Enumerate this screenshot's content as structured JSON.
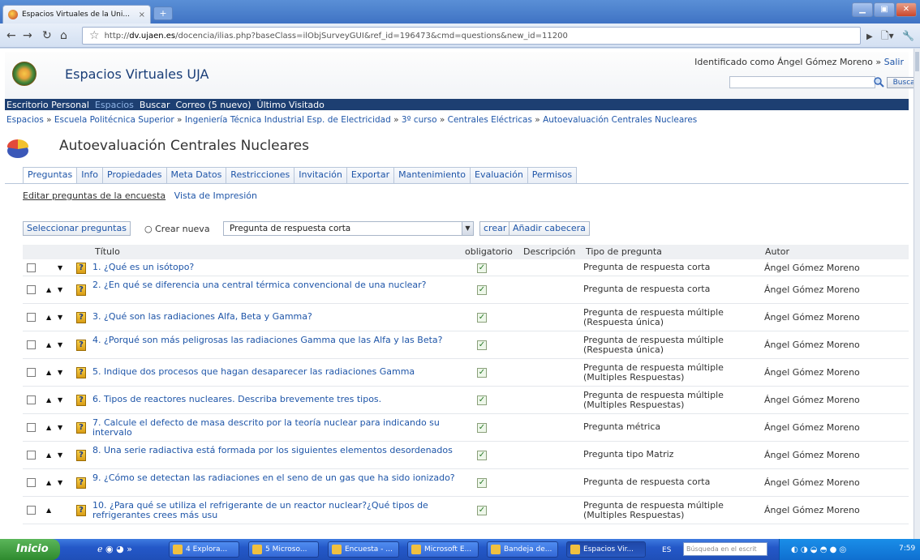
{
  "browser": {
    "tab_title": "Espacios Virtuales de la Uni...",
    "tab_close": "×",
    "new_tab": "+",
    "url_prefix": "http://",
    "url_host": "dv.ujaen.es",
    "url_rest": "/docencia/ilias.php?baseClass=ilObjSurveyGUI&ref_id=196473&cmd=questions&new_id=11200"
  },
  "header": {
    "site_title": "Espacios Virtuales UJA",
    "ident_text": "Identificado como Ángel Gómez Moreno » ",
    "logout": "Salir",
    "search_button": "Buscar"
  },
  "mainnav": [
    "Escritorio Personal",
    "Espacios",
    "Buscar",
    "Correo (5 nuevo)",
    "Último Visitado"
  ],
  "breadcrumbs": [
    "Espacios",
    "Escuela Politécnica Superior",
    "Ingeniería Técnica Industrial Esp. de Electricidad",
    "3º curso",
    "Centrales Eléctricas",
    "Autoevaluación Centrales Nucleares"
  ],
  "page_title": "Autoevaluación Centrales Nucleares",
  "tabs": [
    "Preguntas",
    "Info",
    "Propiedades",
    "Meta Datos",
    "Restricciones",
    "Invitación",
    "Exportar",
    "Mantenimiento",
    "Evaluación",
    "Permisos"
  ],
  "subtabs": [
    "Editar preguntas de la encuesta",
    "Vista de Impresión"
  ],
  "controls": {
    "select_questions": "Seleccionar preguntas",
    "create_new": "Crear nueva",
    "question_type": "Pregunta de respuesta corta",
    "create": "crear",
    "add_header": "Añadir cabecera"
  },
  "table": {
    "headers": [
      "Título",
      "obligatorio",
      "Descripción",
      "Tipo de pregunta",
      "Autor"
    ],
    "rows": [
      {
        "title": "1. ¿Qué es un isótopo?",
        "type": "Pregunta de respuesta corta",
        "author": "Ángel Gómez Moreno"
      },
      {
        "title": "2. ¿En qué se diferencia una central térmica convencional de una nuclear?",
        "type": "Pregunta de respuesta corta",
        "author": "Ángel Gómez Moreno"
      },
      {
        "title": "3. ¿Qué son las radiaciones Alfa, Beta y Gamma?",
        "type": "Pregunta de respuesta múltiple (Respuesta única)",
        "author": "Ángel Gómez Moreno"
      },
      {
        "title": "4. ¿Porqué son más peligrosas las radiaciones Gamma que las Alfa y las Beta?",
        "type": "Pregunta de respuesta múltiple (Respuesta única)",
        "author": "Ángel Gómez Moreno"
      },
      {
        "title": "5. Indique dos procesos que hagan desaparecer las radiaciones Gamma",
        "type": "Pregunta de respuesta múltiple (Multiples Respuestas)",
        "author": "Ángel Gómez Moreno"
      },
      {
        "title": "6. Tipos de reactores nucleares. Describa brevemente tres tipos.",
        "type": "Pregunta de respuesta múltiple (Multiples Respuestas)",
        "author": "Ángel Gómez Moreno"
      },
      {
        "title": "7. Calcule el defecto de masa descrito por la teoría nuclear para indicando su intervalo",
        "type": "Pregunta métrica",
        "author": "Ángel Gómez Moreno"
      },
      {
        "title": "8. Una serie radiactiva está formada por los siguientes elementos desordenados",
        "type": "Pregunta tipo Matriz",
        "author": "Ángel Gómez Moreno"
      },
      {
        "title": "9. ¿Cómo se detectan las radiaciones en el seno de un gas que ha sido ionizado?",
        "type": "Pregunta de respuesta corta",
        "author": "Ángel Gómez Moreno"
      },
      {
        "title": "10. ¿Para qué se utiliza el refrigerante de un reactor nuclear?¿Qué tipos de refrigerantes crees más usu",
        "type": "Pregunta de respuesta múltiple (Multiples Respuestas)",
        "author": "Ángel Gómez Moreno"
      }
    ]
  },
  "taskbar": {
    "start": "Inicio",
    "items": [
      "4 Explora...",
      "5 Microso...",
      "Encuesta - ...",
      "Microsoft E...",
      "Bandeja de...",
      "Espacios Vir..."
    ],
    "lang": "ES",
    "search_placeholder": "Búsqueda en el escrit",
    "clock": "7:59"
  },
  "colors": {
    "link": "#1e55a8",
    "nav_bar": "#1d3f72",
    "taskbar": "#2458c8"
  }
}
